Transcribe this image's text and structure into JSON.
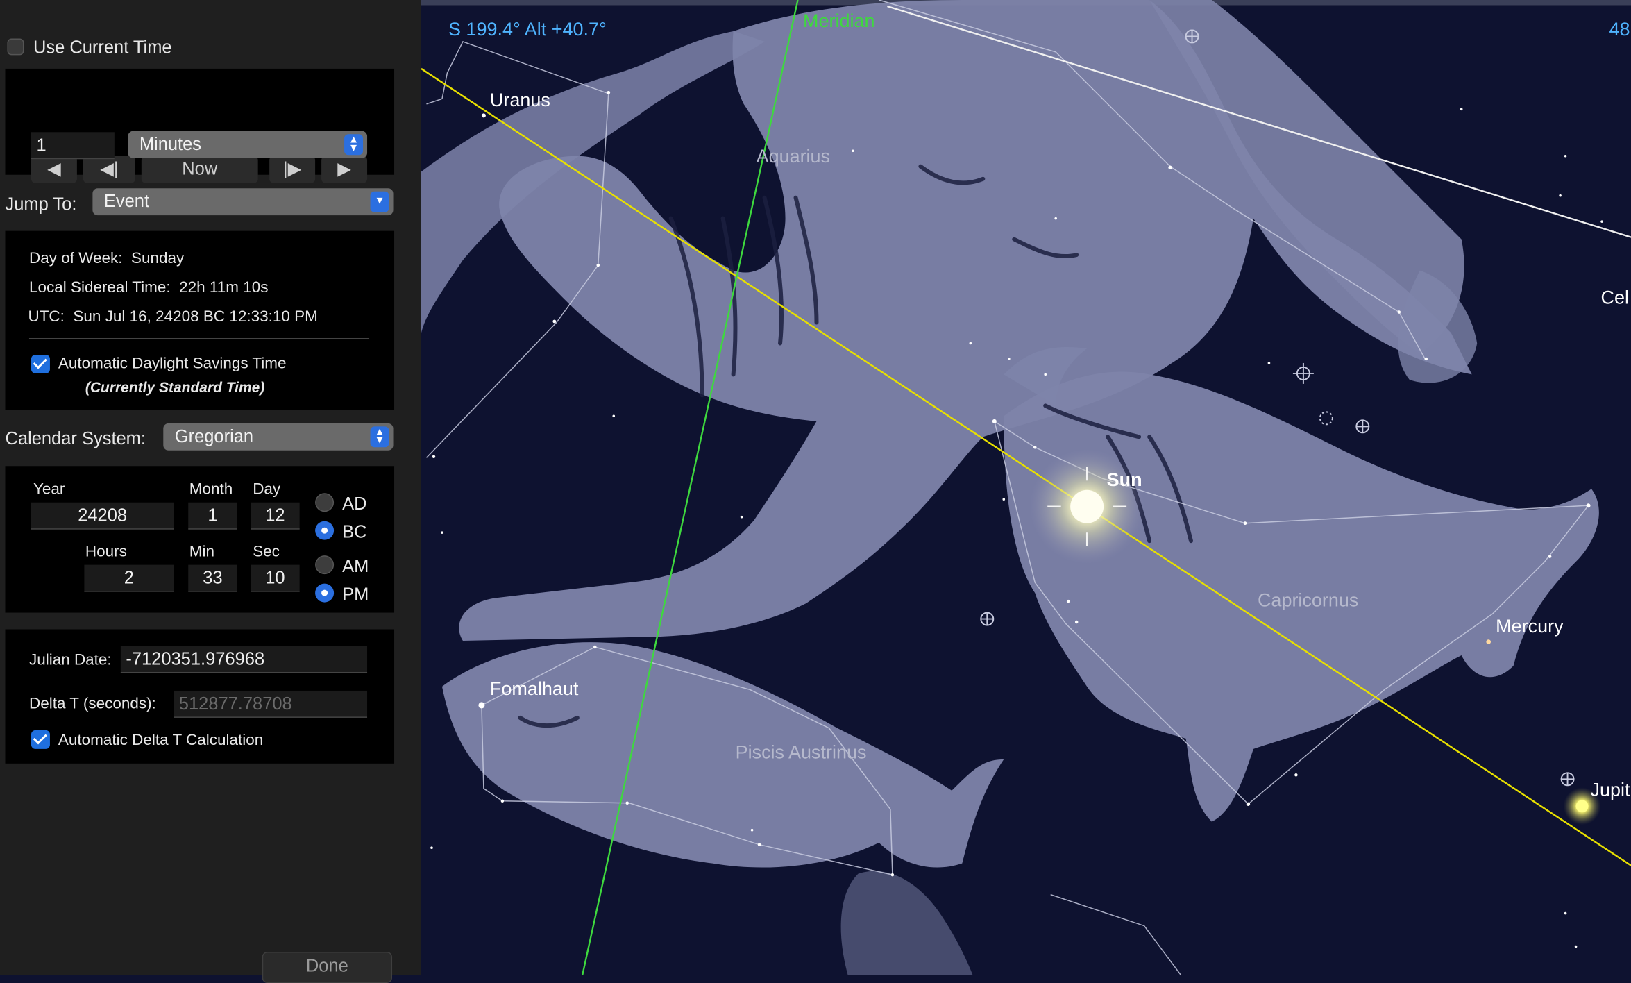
{
  "panel": {
    "use_current_time": {
      "label": "Use Current Time",
      "checked": false
    },
    "step": {
      "now_label": "Now",
      "amount": "1",
      "unit": "Minutes",
      "icons": [
        "rewind-icon",
        "step-back-icon",
        "step-forward-icon",
        "play-icon"
      ]
    },
    "jump_to": {
      "label": "Jump To:",
      "value": "Event"
    },
    "info": {
      "day_of_week_label": "Day of Week:",
      "day_of_week": "Sunday",
      "sidereal_label": "Local Sidereal Time:",
      "sidereal": "22h 11m 10s",
      "utc_label": "UTC:",
      "utc": "Sun Jul 16, 24208 BC 12:33:10 PM",
      "dst_label": "Automatic Daylight Savings Time",
      "dst_checked": true,
      "dst_note": "(Currently Standard Time)"
    },
    "calendar": {
      "label": "Calendar System:",
      "value": "Gregorian"
    },
    "date": {
      "year_label": "Year",
      "year": "24208",
      "month_label": "Month",
      "month": "1",
      "day_label": "Day",
      "day": "12",
      "hours_label": "Hours",
      "hours": "2",
      "min_label": "Min",
      "min": "33",
      "sec_label": "Sec",
      "sec": "10",
      "era_ad": "AD",
      "era_bc": "BC",
      "era_selected": "BC",
      "am": "AM",
      "pm": "PM",
      "ampm_selected": "PM"
    },
    "julian": {
      "label": "Julian Date:",
      "value": "-7120351.976968",
      "delta_label": "Delta T (seconds):",
      "delta_value": "512877.78708",
      "auto_delta_label": "Automatic Delta T Calculation",
      "auto_delta_checked": true
    },
    "done_label": "Done"
  },
  "sky": {
    "pointer_readout": "S 199.4° Alt +40.7°",
    "top_right_readout": "48",
    "meridian_label": "Meridian",
    "constellations": [
      "Aquarius",
      "Capricornus",
      "Piscis Austrinus"
    ],
    "objects": [
      "Uranus",
      "Sun",
      "Fomalhaut",
      "Mercury",
      "Jupit",
      "Cel"
    ],
    "colors": {
      "background": "#0e1230",
      "figure": "#7e84aa",
      "ecliptic": "#e8e000",
      "meridian": "#3ed93e",
      "readout": "#4fb4ff",
      "label": "#ffffff",
      "constellation_label": "#b5b8cc"
    }
  }
}
